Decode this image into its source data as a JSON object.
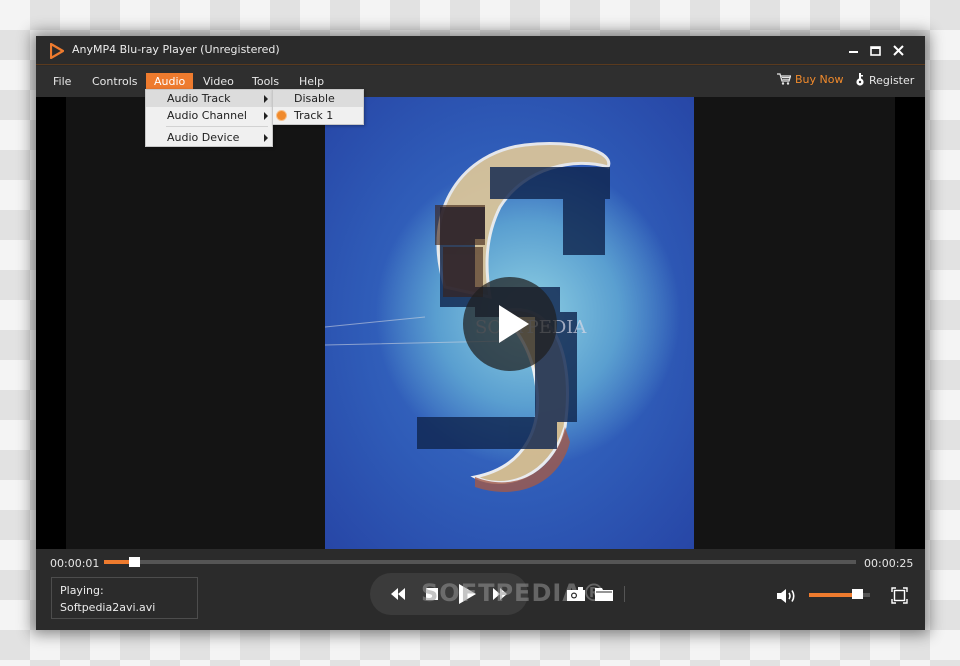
{
  "window": {
    "title": "AnyMP4 Blu-ray Player (Unregistered)",
    "accent_color": "#ee7b2e"
  },
  "window_controls": {
    "minimize_icon": "minimize-icon",
    "maximize_icon": "maximize-icon",
    "close_icon": "close-icon"
  },
  "menubar": {
    "items": [
      {
        "label": "File"
      },
      {
        "label": "Controls"
      },
      {
        "label": "Audio",
        "active": true
      },
      {
        "label": "Video"
      },
      {
        "label": "Tools"
      },
      {
        "label": "Help"
      }
    ],
    "buy_now": {
      "label": "Buy Now",
      "icon": "cart-icon"
    },
    "register": {
      "label": "Register",
      "icon": "key-icon"
    }
  },
  "audio_menu": {
    "items": [
      {
        "label": "Audio Track",
        "has_submenu": true,
        "highlighted": true
      },
      {
        "label": "Audio Channel",
        "has_submenu": true
      },
      {
        "label": "Audio Device",
        "has_submenu": true
      }
    ]
  },
  "audio_track_submenu": {
    "items": [
      {
        "label": "Disable",
        "selected": false,
        "highlighted": true
      },
      {
        "label": "Track 1",
        "selected": true
      }
    ]
  },
  "player": {
    "current_time": "00:00:01",
    "total_time": "00:00:25",
    "progress_fraction": 0.04,
    "volume_fraction": 0.8,
    "playing_label": "Playing:",
    "file_name": "Softpedia2avi.avi",
    "watermark": "SOFTPEDIA®",
    "video_overlay_text": "SOFTPEDIA"
  }
}
